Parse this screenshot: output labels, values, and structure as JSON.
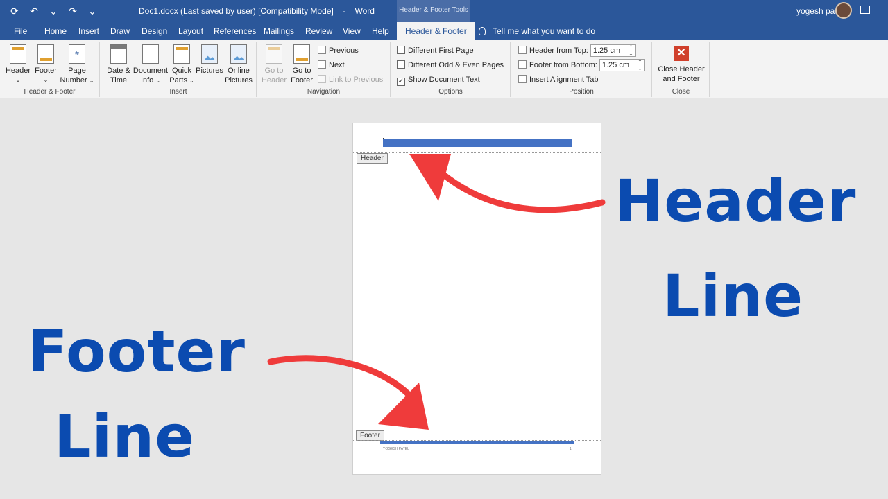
{
  "titlebar": {
    "doc_title": "Doc1.docx (Last saved by user) [Compatibility Mode]",
    "app_sep": "-",
    "app_name": "Word",
    "contextual_tools": "Header & Footer Tools",
    "user_name": "yogesh patel"
  },
  "tabs": [
    "File",
    "Home",
    "Insert",
    "Draw",
    "Design",
    "Layout",
    "References",
    "Mailings",
    "Review",
    "View",
    "Help"
  ],
  "active_tab": "Header & Footer",
  "tell_me": "Tell me what you want to do",
  "ribbon": {
    "header_footer": {
      "label": "Header & Footer",
      "header": "Header",
      "footer": "Footer",
      "page": "Page",
      "number": "Number"
    },
    "insert": {
      "label": "Insert",
      "date": "Date &",
      "time": "Time",
      "document": "Document",
      "info": "Info",
      "quick": "Quick",
      "parts": "Parts",
      "pictures": "Pictures",
      "online": "Online",
      "online_pictures": "Pictures"
    },
    "navigation": {
      "label": "Navigation",
      "goto": "Go to",
      "header": "Header",
      "goto2": "Go to",
      "footer": "Footer",
      "previous": "Previous",
      "next": "Next",
      "link_prev": "Link to Previous"
    },
    "options": {
      "label": "Options",
      "first_page": "Different First Page",
      "odd_even": "Different Odd & Even Pages",
      "show_doc": "Show Document Text",
      "show_doc_checked": "✓"
    },
    "position": {
      "label": "Position",
      "header_top": "Header from Top:",
      "header_top_value": "1.25 cm",
      "footer_bottom": "Footer from Bottom:",
      "footer_bottom_value": "1.25 cm",
      "align_tab": "Insert Alignment Tab"
    },
    "close": {
      "label": "Close",
      "line1": "Close Header",
      "line2": "and Footer"
    }
  },
  "document": {
    "header_tag": "Header",
    "footer_tag": "Footer",
    "footer_left": "YOGESH PATEL",
    "footer_right": "1"
  },
  "annotations": {
    "header_word": "Header",
    "header_line": "Line",
    "footer_word": "Footer",
    "footer_line": "Line",
    "text_color": "#0b4bb0",
    "arrow_color": "#ef3b3b"
  }
}
